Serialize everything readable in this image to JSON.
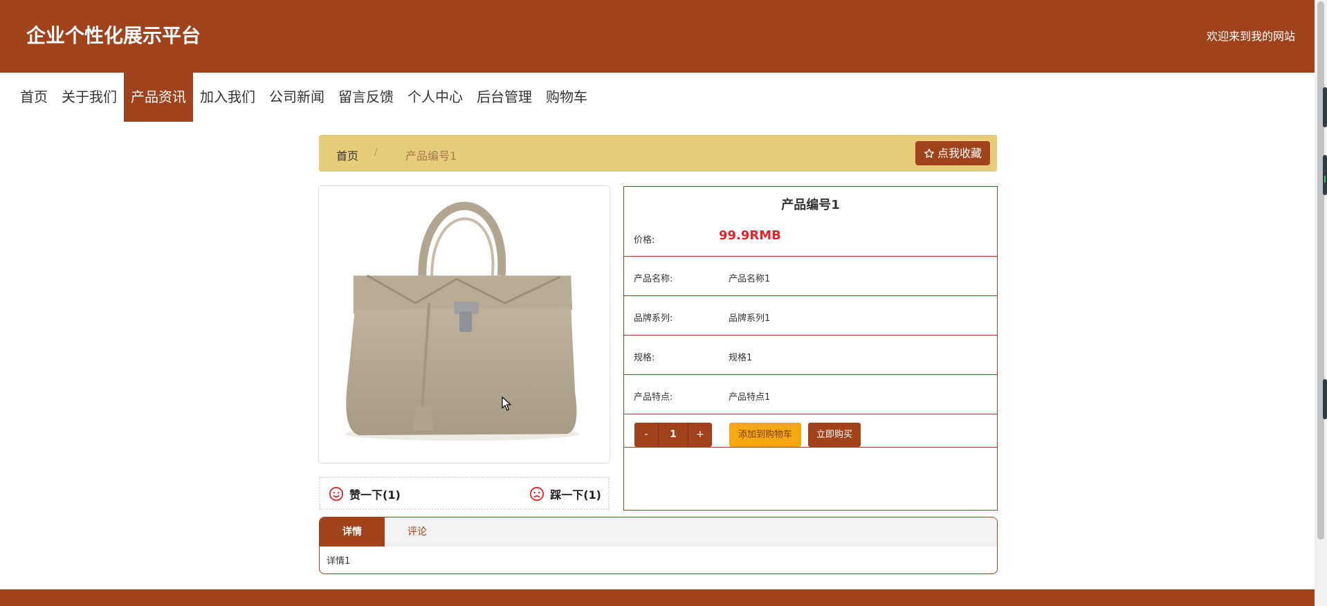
{
  "header": {
    "site_title": "企业个性化展示平台",
    "welcome": "欢迎来到我的网站"
  },
  "nav": {
    "items": [
      "首页",
      "关于我们",
      "产品资讯",
      "加入我们",
      "公司新闻",
      "留言反馈",
      "个人中心",
      "后台管理",
      "购物车"
    ],
    "active_index": 2
  },
  "breadcrumb": {
    "home": "首页",
    "separator": "/",
    "current": "产品编号1",
    "favorite_button": "点我收藏",
    "favorite_icon": "star-outline-icon"
  },
  "product": {
    "title": "产品编号1",
    "price_label": "价格:",
    "price": "99.9RMB",
    "fields": [
      {
        "label": "产品名称:",
        "value": "产品名称1"
      },
      {
        "label": "品牌系列:",
        "value": "品牌系列1"
      },
      {
        "label": "规格:",
        "value": "规格1"
      },
      {
        "label": "产品特点:",
        "value": "产品特点1"
      }
    ],
    "image_alt": "handbag-photo"
  },
  "quantity": {
    "minus": "-",
    "value": "1",
    "plus": "+",
    "add_to_cart": "添加到购物车",
    "buy_now": "立即购买"
  },
  "votes": {
    "like_label": "赞一下(1)",
    "dislike_label": "踩一下(1)",
    "like_icon": "smile-icon",
    "dislike_icon": "frown-icon"
  },
  "tabs": {
    "items": [
      "详情",
      "评论"
    ],
    "active_index": 0,
    "content": "详情1"
  },
  "colors": {
    "brand": "#a0431c",
    "breadcrumb_bg": "#e9cc79",
    "price": "#e3242b",
    "cart_button": "#f5a813"
  }
}
